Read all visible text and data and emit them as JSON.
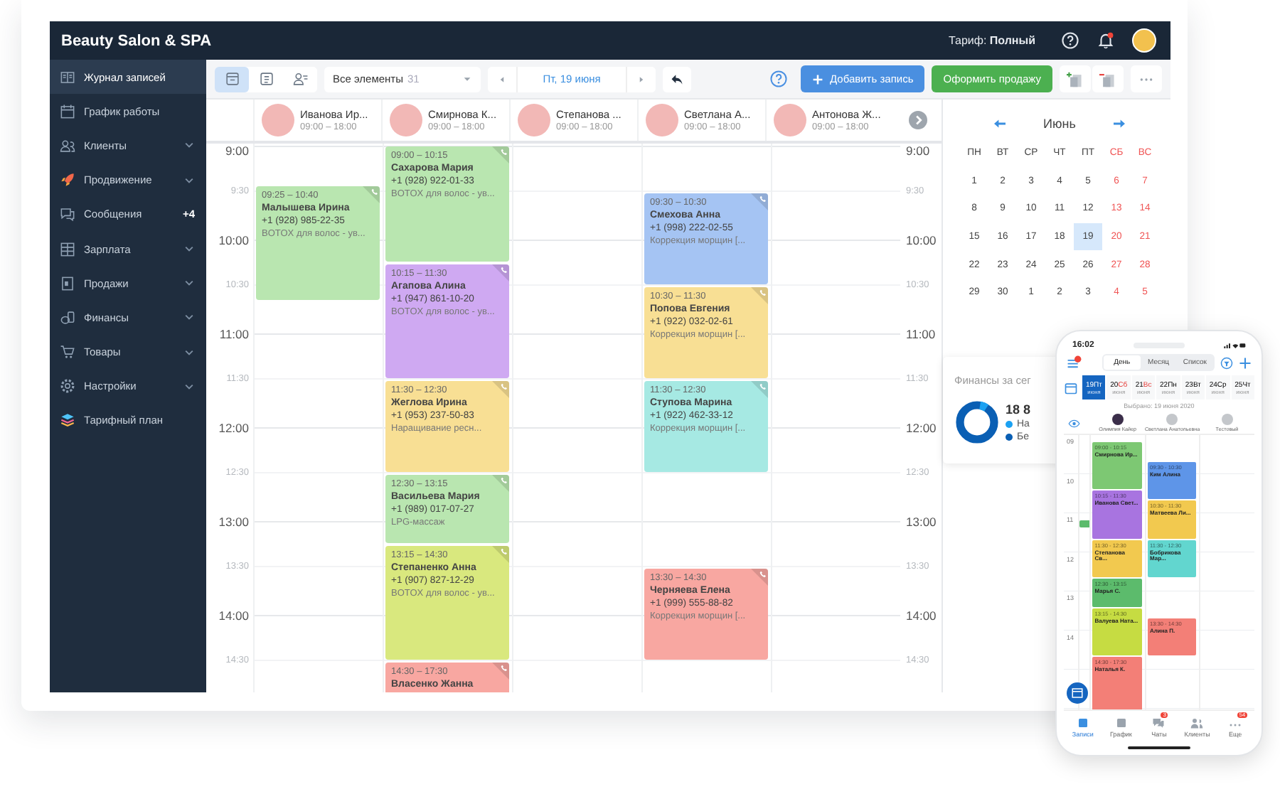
{
  "header": {
    "title": "Beauty Salon & SPA",
    "tariff": "Тариф: **Полный**"
  },
  "sidebar": {
    "items": [
      {
        "label": "Журнал записей",
        "selected": true,
        "has_submenu": false
      },
      {
        "label": "График работы",
        "selected": false,
        "has_submenu": false
      },
      {
        "label": "Клиенты",
        "selected": false,
        "has_submenu": true
      },
      {
        "label": "Продвижение",
        "selected": false,
        "has_submenu": true
      },
      {
        "label": "Сообщения",
        "selected": false,
        "has_submenu": false,
        "badge": "+4"
      },
      {
        "label": "Зарплата",
        "selected": false,
        "has_submenu": true
      },
      {
        "label": "Продажи",
        "selected": false,
        "has_submenu": true
      },
      {
        "label": "Финансы",
        "selected": false,
        "has_submenu": true
      },
      {
        "label": "Товары",
        "selected": false,
        "has_submenu": true
      },
      {
        "label": "Настройки",
        "selected": false,
        "has_submenu": true
      },
      {
        "label": "Тарифный план",
        "selected": false,
        "has_submenu": false
      }
    ]
  },
  "toolbar": {
    "views": [
      {
        "selected": true
      },
      {
        "selected": false
      },
      {
        "selected": false
      }
    ],
    "filter": {
      "label": "Все элементы",
      "count": "31"
    },
    "date": "Пт, 19 июня",
    "add_button": "Добавить запись",
    "sale_button": "Оформить продажу"
  },
  "time_labels_left": [
    "9:00",
    "9:30",
    "10:00",
    "10:30",
    "11:00",
    "11:30",
    "12:00",
    "12:30",
    "13:00",
    "13:30",
    "14:00",
    "14:30"
  ],
  "time_labels_right": [
    "9:00",
    "9:30",
    "10:00",
    "10:30",
    "11:00",
    "11:30",
    "12:00",
    "12:30",
    "13:00",
    "13:30",
    "14:00",
    "14:30"
  ],
  "staff": [
    {
      "name": "Иванова Ир...",
      "hours": "09:00 – 18:00",
      "appointments": [
        {
          "time": "09:25 – 10:40",
          "client": "Малышева Ирина",
          "phone": "+1 (928) 985-22-35",
          "service": "BOTOX для волос - ув...",
          "color": "#b9e6b0"
        }
      ]
    },
    {
      "name": "Смирнова К...",
      "hours": "09:00 – 18:00",
      "appointments": [
        {
          "time": "09:00 – 10:15",
          "client": "Сахарова Мария",
          "phone": "+1 (928) 922-01-33",
          "service": "BOTOX для волос - ув...",
          "color": "#b9e6b0"
        },
        {
          "time": "10:15 – 11:30",
          "client": "Агапова Алина",
          "phone": "+1 (947) 861-10-20",
          "service": "BOTOX для волос - ув...",
          "color": "#cfa9f2"
        },
        {
          "time": "11:30 – 12:30",
          "client": "Жеглова Ирина",
          "phone": "+1 (953) 237-50-83",
          "service": "Наращивание ресн...",
          "color": "#f8df94"
        },
        {
          "time": "12:30 – 13:15",
          "client": "Васильева Мария",
          "phone": "+1 (989) 017-07-27",
          "service": "LPG-массаж",
          "color": "#b9e6b0"
        },
        {
          "time": "13:15 – 14:30",
          "client": "Степаненко Анна",
          "phone": "+1 (907) 827-12-29",
          "service": "BOTOX для волос - ув...",
          "color": "#d9e87e"
        },
        {
          "time": "14:30 – 17:30",
          "client": "Власенко Жанна",
          "color": "#f8a7a1"
        }
      ]
    },
    {
      "name": "Степанова ...",
      "hours": "09:00 – 18:00"
    },
    {
      "name": "Светлана А...",
      "hours": "09:00 – 18:00",
      "appointments": [
        {
          "time": "09:30 – 10:30",
          "client": "Смехова Анна",
          "phone": "+1 (998) 222-02-55",
          "service": "Коррекция морщин [...",
          "color": "#a5c4f3"
        },
        {
          "time": "10:30 – 11:30",
          "client": "Попова Евгения",
          "phone": "+1 (922) 032-02-61",
          "service": "Коррекция морщин [...",
          "color": "#f8df94"
        },
        {
          "time": "11:30 – 12:30",
          "client": "Ступова Марина",
          "phone": "+1 (922) 462-33-12",
          "service": "Коррекция морщин [...",
          "color": "#a6e9e3"
        },
        {
          "time": "13:30 – 14:30",
          "client": "Черняева Елена",
          "phone": "+1 (999) 555-88-82",
          "service": "Коррекция морщин [...",
          "color": "#f8a7a1"
        }
      ]
    },
    {
      "name": "Антонова Ж...",
      "hours": "09:00 – 18:00"
    }
  ],
  "calendar": {
    "month": "Июнь",
    "weekdays": [
      {
        "label": "ПН",
        "weekend": false
      },
      {
        "label": "ВТ",
        "weekend": false
      },
      {
        "label": "СР",
        "weekend": false
      },
      {
        "label": "ЧТ",
        "weekend": false
      },
      {
        "label": "ПТ",
        "weekend": false
      },
      {
        "label": "СБ",
        "weekend": true
      },
      {
        "label": "ВС",
        "weekend": true
      }
    ],
    "weeks": [
      [
        {
          "day": "1",
          "selected": false
        },
        {
          "day": "2",
          "selected": false
        },
        {
          "day": "3",
          "selected": false
        },
        {
          "day": "4",
          "selected": false
        },
        {
          "day": "5",
          "selected": false
        },
        {
          "day": "6",
          "selected": false
        },
        {
          "day": "7",
          "selected": false
        }
      ],
      [
        {
          "day": "8",
          "selected": false
        },
        {
          "day": "9",
          "selected": false
        },
        {
          "day": "10",
          "selected": false
        },
        {
          "day": "11",
          "selected": false
        },
        {
          "day": "12",
          "selected": false
        },
        {
          "day": "13",
          "selected": false
        },
        {
          "day": "14",
          "selected": false
        }
      ],
      [
        {
          "day": "15",
          "selected": false
        },
        {
          "day": "16",
          "selected": false
        },
        {
          "day": "17",
          "selected": false
        },
        {
          "day": "18",
          "selected": false
        },
        {
          "day": "19",
          "selected": true
        },
        {
          "day": "20",
          "selected": false
        },
        {
          "day": "21",
          "selected": false
        }
      ],
      [
        {
          "day": "22",
          "selected": false
        },
        {
          "day": "23",
          "selected": false
        },
        {
          "day": "24",
          "selected": false
        },
        {
          "day": "25",
          "selected": false
        },
        {
          "day": "26",
          "selected": false
        },
        {
          "day": "27",
          "selected": false
        },
        {
          "day": "28",
          "selected": false
        }
      ],
      [
        {
          "day": "29",
          "selected": false
        },
        {
          "day": "30",
          "selected": false
        },
        {
          "day": "1",
          "selected": false
        },
        {
          "day": "2",
          "selected": false
        },
        {
          "day": "3",
          "selected": false
        },
        {
          "day": "4",
          "selected": false
        },
        {
          "day": "5",
          "selected": false
        }
      ]
    ]
  },
  "finance": {
    "title": "Финансы за сег",
    "total": "18 8",
    "legend": [
      {
        "label": "На",
        "color": "#1ba1f2"
      },
      {
        "label": "Бе",
        "color": "#0a5fb4"
      }
    ]
  },
  "phone": {
    "time": "16:02",
    "tabs": [
      {
        "label": "День",
        "selected": true
      },
      {
        "label": "Месяц",
        "selected": false
      },
      {
        "label": "Список",
        "selected": false
      }
    ],
    "dates": [
      {
        "day": "19",
        "weekday": "Пт",
        "month": "июня",
        "selected": true,
        "weekend": false
      },
      {
        "day": "20",
        "weekday": "Сб",
        "month": "июня",
        "selected": false,
        "weekend": true
      },
      {
        "day": "21",
        "weekday": "Вс",
        "month": "июня",
        "selected": false,
        "weekend": true
      },
      {
        "day": "22",
        "weekday": "Пн",
        "month": "июня",
        "selected": false,
        "weekend": false
      },
      {
        "day": "23",
        "weekday": "Вт",
        "month": "июня",
        "selected": false,
        "weekend": false
      },
      {
        "day": "24",
        "weekday": "Ср",
        "month": "июня",
        "selected": false,
        "weekend": false
      },
      {
        "day": "25",
        "weekday": "Чт",
        "month": "июня",
        "selected": false,
        "weekend": false
      }
    ],
    "selected_text": "Выбрано: 19 июня 2020",
    "hours": [
      "09",
      "10",
      "11",
      "12",
      "13",
      "14"
    ],
    "columns": [
      {
        "name": "Олимпия Кайер",
        "appointments": [
          {
            "time": "09:00 - 10:15",
            "client": "Смирнова Ир...",
            "color": "#7dc873"
          },
          {
            "time": "10:15 - 11:30",
            "client": "Иванова Свет...",
            "color": "#a874e0"
          },
          {
            "time": "11:30 - 12:30",
            "client": "Степанова Св...",
            "color": "#f2c94f"
          },
          {
            "time": "12:30 - 13:15",
            "client": "Марья С.",
            "color": "#5cbb6c"
          },
          {
            "time": "13:15 - 14:30",
            "client": "Валуева Ната...",
            "color": "#c6dc42"
          },
          {
            "time": "14:30 - 17:30",
            "client": "Наталья К.",
            "color": "#f37f77"
          }
        ]
      },
      {
        "name": "Светлана Анатольевна",
        "appointments": [
          {
            "time": "09:30 - 10:30",
            "client": "Ким Алина",
            "color": "#5e95e8"
          },
          {
            "time": "10:30 - 11:30",
            "client": "Матвеева Ли...",
            "color": "#f2c94f"
          },
          {
            "time": "11:30 - 12:30",
            "client": "Бобрикова Мар...",
            "color": "#62d6cf"
          },
          {
            "time": "13:30 - 14:30",
            "client": "Алина П.",
            "color": "#f37f77"
          }
        ]
      },
      {
        "name": "Тестовый"
      }
    ],
    "nav": [
      {
        "label": "Записи",
        "selected": true
      },
      {
        "label": "График",
        "selected": false
      },
      {
        "label": "Чаты",
        "selected": false,
        "badge": "3"
      },
      {
        "label": "Клиенты",
        "selected": false
      },
      {
        "label": "Еще",
        "selected": false,
        "badge": "54"
      }
    ]
  }
}
